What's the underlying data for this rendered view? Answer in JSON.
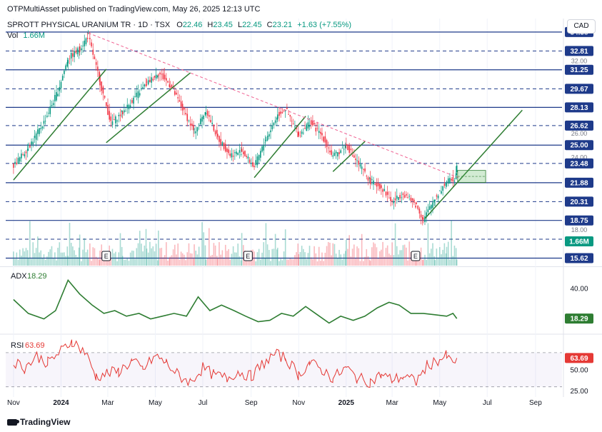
{
  "header": {
    "published": "OTPMultiAsset published on TradingView.com, May 26, 2025 12:13 UTC",
    "symbol": "SPROTT PHYSICAL URANIUM TR · 1D · TSX",
    "o_label": "O",
    "o_val": "22.46",
    "h_label": "H",
    "h_val": "23.45",
    "l_label": "L",
    "l_val": "22.45",
    "c_label": "C",
    "c_val": "23.21",
    "change": "+1.63 (+7.55%)",
    "vol_label": "Vol",
    "vol_val": "1.66M",
    "currency": "CAD"
  },
  "footer": {
    "brand": "TradingView"
  },
  "colors": {
    "up": "#089981",
    "down": "#f23645",
    "level": "#1e3a8a",
    "trend": "#2e7d32",
    "resistance": "#f06292",
    "adx": "#2e7d32",
    "rsi": "#e53935",
    "axis_text": "#131722"
  },
  "chart_data": [
    {
      "type": "candlestick",
      "title": "SPROTT PHYSICAL URANIUM TR · 1D · TSX",
      "x_ticks": [
        "Nov",
        "2024",
        "Mar",
        "May",
        "Jul",
        "Sep",
        "Nov",
        "2025",
        "Mar",
        "May",
        "Jul",
        "Sep"
      ],
      "y_ticks": [
        "18.00",
        "24.00",
        "26.00",
        "32.00"
      ],
      "y_range": [
        15.0,
        35.5
      ],
      "last_price": 23.21,
      "levels": [
        {
          "value": 34.38,
          "label": "34.38",
          "style": "solid"
        },
        {
          "value": 32.81,
          "label": "32.81",
          "style": "dashed"
        },
        {
          "value": 31.25,
          "label": "31.25",
          "style": "solid"
        },
        {
          "value": 29.67,
          "label": "29.67",
          "style": "dashed"
        },
        {
          "value": 28.13,
          "label": "28.13",
          "style": "solid"
        },
        {
          "value": 26.62,
          "label": "26.62",
          "style": "dashed"
        },
        {
          "value": 25.0,
          "label": "25.00",
          "style": "solid"
        },
        {
          "value": 23.48,
          "label": "23.48",
          "style": "dashed"
        },
        {
          "value": 21.88,
          "label": "21.88",
          "style": "solid"
        },
        {
          "value": 20.31,
          "label": "20.31",
          "style": "dashed"
        },
        {
          "value": 18.75,
          "label": "18.75",
          "style": "solid"
        },
        {
          "value": 17.19,
          "label": "",
          "style": "dashed"
        },
        {
          "value": 15.62,
          "label": "15.62",
          "style": "solid"
        }
      ],
      "price_path": [
        [
          "2023-11-01",
          23.3
        ],
        [
          "2023-11-20",
          24.8
        ],
        [
          "2023-12-10",
          26.9
        ],
        [
          "2023-12-28",
          29.5
        ],
        [
          "2024-01-10",
          32.2
        ],
        [
          "2024-01-25",
          33.0
        ],
        [
          "2024-02-05",
          34.1
        ],
        [
          "2024-02-20",
          30.2
        ],
        [
          "2024-03-05",
          26.8
        ],
        [
          "2024-03-20",
          27.7
        ],
        [
          "2024-04-05",
          29.0
        ],
        [
          "2024-04-20",
          30.1
        ],
        [
          "2024-05-05",
          31.0
        ],
        [
          "2024-05-20",
          30.0
        ],
        [
          "2024-06-05",
          28.0
        ],
        [
          "2024-06-20",
          26.1
        ],
        [
          "2024-07-05",
          27.9
        ],
        [
          "2024-07-20",
          25.6
        ],
        [
          "2024-08-05",
          24.2
        ],
        [
          "2024-08-20",
          24.5
        ],
        [
          "2024-09-05",
          23.2
        ],
        [
          "2024-09-20",
          25.5
        ],
        [
          "2024-10-05",
          27.5
        ],
        [
          "2024-10-15",
          28.0
        ],
        [
          "2024-11-01",
          25.8
        ],
        [
          "2024-11-15",
          26.9
        ],
        [
          "2024-12-01",
          25.8
        ],
        [
          "2024-12-15",
          24.0
        ],
        [
          "2025-01-01",
          25.0
        ],
        [
          "2025-01-15",
          23.6
        ],
        [
          "2025-02-01",
          22.0
        ],
        [
          "2025-02-15",
          21.5
        ],
        [
          "2025-03-01",
          20.3
        ],
        [
          "2025-03-15",
          21.0
        ],
        [
          "2025-04-01",
          20.0
        ],
        [
          "2025-04-10",
          18.8
        ],
        [
          "2025-04-25",
          20.6
        ],
        [
          "2025-05-10",
          22.0
        ],
        [
          "2025-05-20",
          22.2
        ],
        [
          "2025-05-23",
          23.21
        ]
      ],
      "earnings_markers": [
        {
          "date": "2024-02-28",
          "label": "E"
        },
        {
          "date": "2024-08-28",
          "label": "E"
        },
        {
          "date": "2025-03-31",
          "label": "E"
        }
      ],
      "trendlines": [
        {
          "name": "support-1",
          "from": [
            "2023-11-01",
            22.1
          ],
          "to": [
            "2024-02-28",
            31.3
          ]
        },
        {
          "name": "support-2",
          "from": [
            "2024-02-28",
            25.2
          ],
          "to": [
            "2024-06-15",
            31.0
          ]
        },
        {
          "name": "support-3",
          "from": [
            "2024-09-05",
            22.3
          ],
          "to": [
            "2024-11-10",
            27.4
          ]
        },
        {
          "name": "support-4",
          "from": [
            "2024-12-15",
            22.8
          ],
          "to": [
            "2025-01-25",
            25.3
          ]
        },
        {
          "name": "support-5",
          "from": [
            "2025-04-12",
            18.9
          ],
          "to": [
            "2025-08-15",
            27.9
          ]
        },
        {
          "name": "resistance",
          "from": [
            "2024-02-05",
            34.3
          ],
          "to": [
            "2025-05-25",
            22.3
          ]
        }
      ],
      "highlight_zone": {
        "from": "2025-05-24",
        "to": "2025-06-29",
        "low": 21.9,
        "high": 22.9
      },
      "volume": {
        "label": "Vol",
        "last": "1.66M",
        "last_label": "1.66M"
      }
    },
    {
      "type": "line",
      "name": "ADX",
      "value_label": "18.29",
      "y_ticks": [
        "40.00"
      ],
      "y_range": [
        8,
        55
      ],
      "points": [
        [
          "2023-11-01",
          32
        ],
        [
          "2023-11-20",
          22
        ],
        [
          "2023-12-10",
          18
        ],
        [
          "2023-12-25",
          24
        ],
        [
          "2024-01-10",
          46
        ],
        [
          "2024-01-25",
          36
        ],
        [
          "2024-02-10",
          28
        ],
        [
          "2024-02-25",
          22
        ],
        [
          "2024-03-10",
          24
        ],
        [
          "2024-03-25",
          20
        ],
        [
          "2024-04-10",
          22
        ],
        [
          "2024-04-25",
          18
        ],
        [
          "2024-05-10",
          20
        ],
        [
          "2024-05-25",
          22
        ],
        [
          "2024-06-10",
          20
        ],
        [
          "2024-06-25",
          34
        ],
        [
          "2024-07-10",
          24
        ],
        [
          "2024-07-25",
          28
        ],
        [
          "2024-08-10",
          24
        ],
        [
          "2024-08-25",
          20
        ],
        [
          "2024-09-10",
          16
        ],
        [
          "2024-09-25",
          17
        ],
        [
          "2024-10-10",
          22
        ],
        [
          "2024-10-25",
          20
        ],
        [
          "2024-11-10",
          27
        ],
        [
          "2024-11-25",
          21
        ],
        [
          "2024-12-10",
          15
        ],
        [
          "2024-12-25",
          20
        ],
        [
          "2025-01-10",
          17
        ],
        [
          "2025-01-25",
          20
        ],
        [
          "2025-02-10",
          26
        ],
        [
          "2025-02-25",
          30
        ],
        [
          "2025-03-10",
          28
        ],
        [
          "2025-03-25",
          22
        ],
        [
          "2025-04-10",
          22
        ],
        [
          "2025-04-25",
          21
        ],
        [
          "2025-05-10",
          20
        ],
        [
          "2025-05-18",
          22
        ],
        [
          "2025-05-23",
          18.29
        ]
      ]
    },
    {
      "type": "line",
      "name": "RSI",
      "value_label": "63.69",
      "y_ticks": [
        "50.00",
        "25.00"
      ],
      "y_range": [
        18,
        90
      ],
      "bands": [
        70,
        30
      ],
      "points": [
        [
          "2023-11-01",
          60
        ],
        [
          "2023-11-15",
          52
        ],
        [
          "2023-12-01",
          66
        ],
        [
          "2023-12-15",
          58
        ],
        [
          "2024-01-01",
          72
        ],
        [
          "2024-01-15",
          84
        ],
        [
          "2024-02-01",
          70
        ],
        [
          "2024-02-15",
          42
        ],
        [
          "2024-03-01",
          46
        ],
        [
          "2024-03-15",
          48
        ],
        [
          "2024-04-01",
          60
        ],
        [
          "2024-04-15",
          50
        ],
        [
          "2024-05-01",
          66
        ],
        [
          "2024-05-15",
          58
        ],
        [
          "2024-06-01",
          42
        ],
        [
          "2024-06-15",
          36
        ],
        [
          "2024-07-01",
          52
        ],
        [
          "2024-07-15",
          44
        ],
        [
          "2024-08-01",
          40
        ],
        [
          "2024-08-15",
          48
        ],
        [
          "2024-09-01",
          42
        ],
        [
          "2024-09-15",
          56
        ],
        [
          "2024-10-01",
          68
        ],
        [
          "2024-10-15",
          64
        ],
        [
          "2024-11-01",
          44
        ],
        [
          "2024-11-15",
          58
        ],
        [
          "2024-12-01",
          50
        ],
        [
          "2024-12-15",
          40
        ],
        [
          "2025-01-01",
          52
        ],
        [
          "2025-01-15",
          40
        ],
        [
          "2025-02-01",
          36
        ],
        [
          "2025-02-15",
          44
        ],
        [
          "2025-03-01",
          38
        ],
        [
          "2025-03-15",
          42
        ],
        [
          "2025-04-01",
          36
        ],
        [
          "2025-04-15",
          55
        ],
        [
          "2025-05-01",
          62
        ],
        [
          "2025-05-10",
          66
        ],
        [
          "2025-05-18",
          56
        ],
        [
          "2025-05-23",
          63.69
        ]
      ]
    }
  ]
}
